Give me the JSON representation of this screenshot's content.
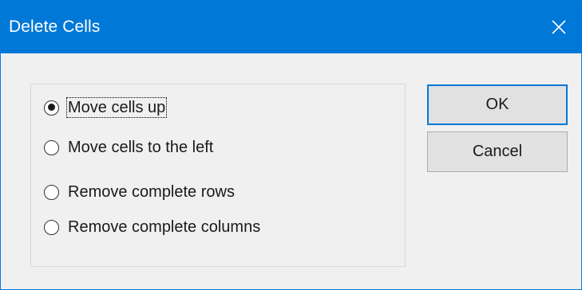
{
  "window": {
    "title": "Delete Cells",
    "close_glyph": "close-icon"
  },
  "options": [
    {
      "label": "Move cells up",
      "checked": true
    },
    {
      "label": "Move cells to the left",
      "checked": false
    },
    {
      "label": "Remove complete rows",
      "checked": false
    },
    {
      "label": "Remove complete columns",
      "checked": false
    }
  ],
  "buttons": {
    "ok_label": "OK",
    "cancel_label": "Cancel"
  },
  "colors": {
    "titlebar": "#0078d7",
    "dialog_bg": "#f0f0f0",
    "default_button_border": "#0078d7"
  }
}
